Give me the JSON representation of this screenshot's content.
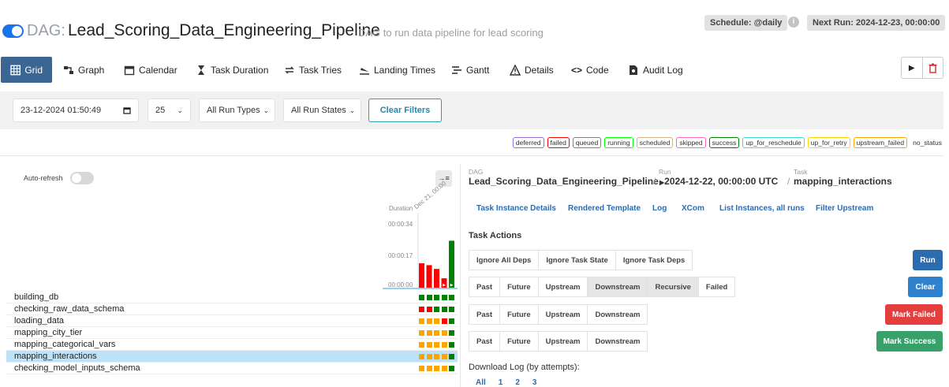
{
  "header": {
    "dag_prefix": "DAG:",
    "dag_id": "Lead_Scoring_Data_Engineering_Pipeline",
    "description": "DAG to run data pipeline for lead scoring",
    "schedule": "Schedule: @daily",
    "info_icon": "i",
    "next_run": "Next Run: 2024-12-23, 00:00:00"
  },
  "nav": {
    "tabs": [
      {
        "label": "Grid",
        "icon": "grid-icon"
      },
      {
        "label": "Graph",
        "icon": "graph-icon"
      },
      {
        "label": "Calendar",
        "icon": "calendar-icon"
      },
      {
        "label": "Task Duration",
        "icon": "hourglass-icon"
      },
      {
        "label": "Task Tries",
        "icon": "retry-icon"
      },
      {
        "label": "Landing Times",
        "icon": "landing-icon"
      },
      {
        "label": "Gantt",
        "icon": "gantt-icon"
      },
      {
        "label": "Details",
        "icon": "warning-icon"
      },
      {
        "label": "Code",
        "icon": "code-icon"
      },
      {
        "label": "Audit Log",
        "icon": "audit-icon"
      }
    ],
    "play_icon": "▶",
    "trash_icon": "trash-icon"
  },
  "filters": {
    "datetime": "23-12-2024 01:50:49",
    "num_runs": "25",
    "run_types": "All Run Types",
    "run_states": "All Run States",
    "clear_filters": "Clear Filters"
  },
  "legend": [
    {
      "label": "deferred",
      "color": "#9370db"
    },
    {
      "label": "failed",
      "color": "#ff0000"
    },
    {
      "label": "queued",
      "color": "#808080"
    },
    {
      "label": "running",
      "color": "#00ff00"
    },
    {
      "label": "scheduled",
      "color": "#d2b48c"
    },
    {
      "label": "skipped",
      "color": "#ff69b4"
    },
    {
      "label": "success",
      "color": "#008000"
    },
    {
      "label": "up_for_reschedule",
      "color": "#40e0d0"
    },
    {
      "label": "up_for_retry",
      "color": "#ffd700"
    },
    {
      "label": "upstream_failed",
      "color": "#ffa500"
    }
  ],
  "legend_no_status": "no_status",
  "grid": {
    "auto_refresh": "Auto-refresh",
    "collapse_icon": "→≡",
    "duration_label": "Duration",
    "run_date_label": "Dec 21, 00:00",
    "ticks": [
      "00:00:34",
      "00:00:17",
      "00:00:00"
    ]
  },
  "chart_data": {
    "type": "bar",
    "ylabel": "Duration",
    "ylim": [
      0,
      34
    ],
    "series": [
      {
        "values": [
          13,
          12,
          10,
          5,
          25
        ]
      }
    ],
    "colors": [
      "#ff0000",
      "#ff0000",
      "#ff0000",
      "#ff0000",
      "#008000"
    ]
  },
  "tasks": [
    {
      "name": "building_db",
      "states": [
        "success",
        "success",
        "success",
        "success",
        "success"
      ]
    },
    {
      "name": "checking_raw_data_schema",
      "states": [
        "failed",
        "failed",
        "success",
        "success",
        "success"
      ]
    },
    {
      "name": "loading_data",
      "states": [
        "upstream_failed",
        "upstream_failed",
        "upstream_failed",
        "failed",
        "success"
      ]
    },
    {
      "name": "mapping_city_tier",
      "states": [
        "upstream_failed",
        "upstream_failed",
        "upstream_failed",
        "upstream_failed",
        "success"
      ]
    },
    {
      "name": "mapping_categorical_vars",
      "states": [
        "upstream_failed",
        "upstream_failed",
        "upstream_failed",
        "upstream_failed",
        "success"
      ]
    },
    {
      "name": "mapping_interactions",
      "states": [
        "upstream_failed",
        "upstream_failed",
        "upstream_failed",
        "upstream_failed",
        "success"
      ],
      "selected": true
    },
    {
      "name": "checking_model_inputs_schema",
      "states": [
        "upstream_failed",
        "upstream_failed",
        "upstream_failed",
        "upstream_failed",
        "success"
      ]
    }
  ],
  "state_colors": {
    "success": "#008000",
    "failed": "#ff0000",
    "upstream_failed": "#ffa500"
  },
  "details": {
    "dag_label": "DAG",
    "dag_value": "Lead_Scoring_Data_Engineering_Pipeline",
    "run_label": "Run",
    "run_value": "2024-12-22, 00:00:00 UTC",
    "task_label": "Task",
    "task_value": "mapping_interactions",
    "sep": "/",
    "tabs": [
      "Task Instance Details",
      "Rendered Template",
      "Log",
      "XCom",
      "List Instances, all runs",
      "Filter Upstream"
    ],
    "task_actions_title": "Task Actions",
    "run_group": [
      "Ignore All Deps",
      "Ignore Task State",
      "Ignore Task Deps"
    ],
    "run_button": "Run",
    "clear_group": [
      "Past",
      "Future",
      "Upstream",
      "Downstream",
      "Recursive",
      "Failed"
    ],
    "clear_button": "Clear",
    "failed_group": [
      "Past",
      "Future",
      "Upstream",
      "Downstream"
    ],
    "mark_failed_button": "Mark Failed",
    "success_group": [
      "Past",
      "Future",
      "Upstream",
      "Downstream"
    ],
    "mark_success_button": "Mark Success",
    "download_log": "Download Log (by attempts):",
    "download_links": [
      "All",
      "1",
      "2",
      "3"
    ]
  }
}
